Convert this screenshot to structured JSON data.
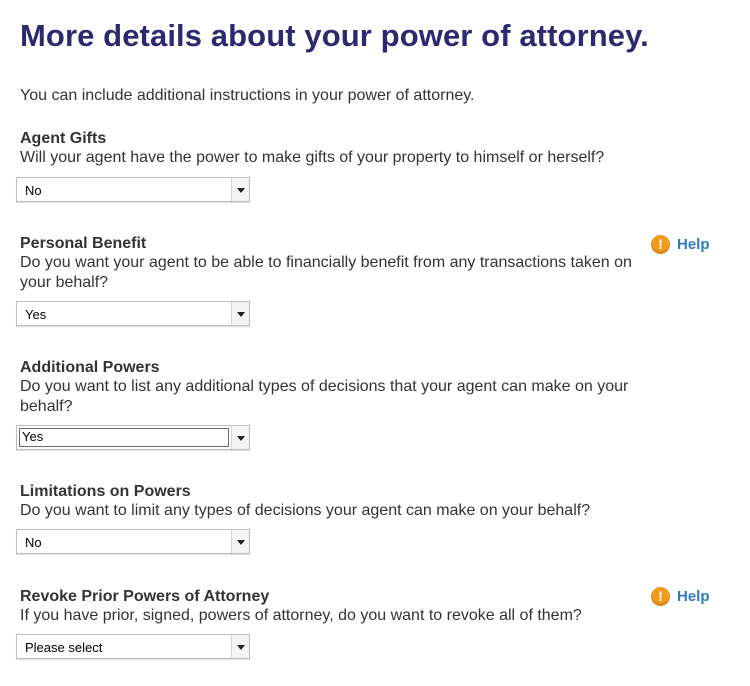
{
  "page": {
    "title": "More details about your power of attorney.",
    "intro": "You can include additional instructions in your power of attorney."
  },
  "sections": [
    {
      "title": "Agent Gifts",
      "question": "Will your agent have the power to make gifts of your property to himself or herself?",
      "selected": "No"
    },
    {
      "title": "Personal Benefit",
      "question": "Do you want your agent to be able to financially benefit from any transactions taken on your behalf?",
      "selected": "Yes",
      "help_label": "Help"
    },
    {
      "title": "Additional Powers",
      "question": "Do you want to list any additional types of decisions that your agent can make on your behalf?",
      "selected": "Yes"
    },
    {
      "title": "Limitations on Powers",
      "question": "Do you want to limit any types of decisions your agent can make on your behalf?",
      "selected": "No"
    },
    {
      "title": "Revoke Prior Powers of Attorney",
      "question": "If you have prior, signed, powers of attorney, do you want to revoke all of them?",
      "selected": "Please select",
      "help_label": "Help"
    }
  ],
  "colors": {
    "title": "#2b2a6e",
    "help_icon": "#f39a1f",
    "help_link": "#2f7cc0"
  },
  "icons": {
    "help": "exclamation-circle-icon",
    "dropdown": "chevron-down-icon"
  }
}
